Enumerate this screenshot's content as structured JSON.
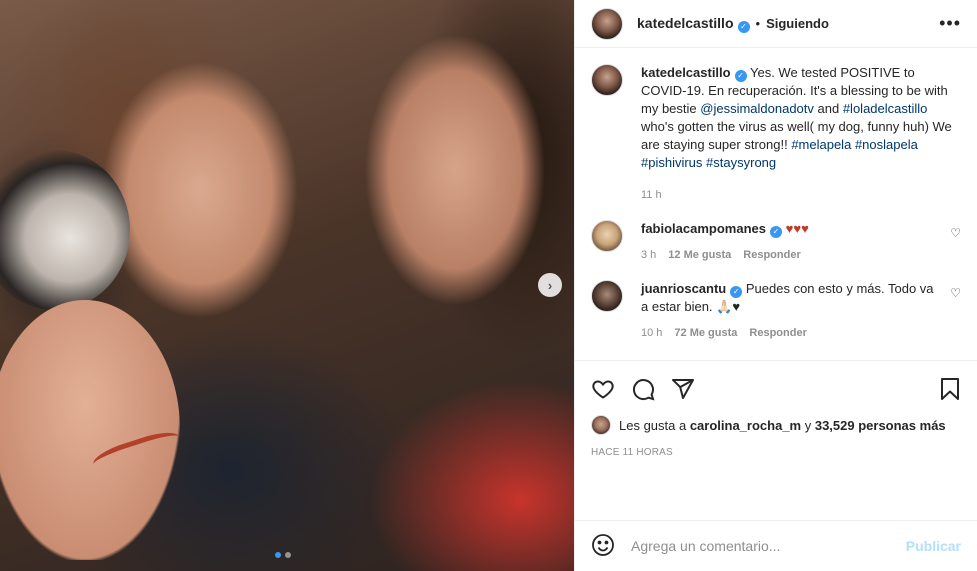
{
  "header": {
    "username": "katedelcastillo",
    "separator": "•",
    "follow_status": "Siguiendo",
    "more": "•••"
  },
  "caption": {
    "username": "katedelcastillo",
    "text_1": "Yes. We tested POSITIVE to COVID-19. En recuperación. It's a blessing to be with my bestie ",
    "mention_1": "@jessimaldonadotv",
    "text_2": " and ",
    "mention_2": "#loladelcastillo",
    "text_3": " who's gotten the virus as well( my dog, funny huh) We are staying super strong!! ",
    "hashtags": [
      "#melapela",
      "#noslapela",
      "#pishivirus",
      "#staysyrong"
    ],
    "time": "11 h"
  },
  "comments": [
    {
      "username": "fabiolacampomanes",
      "text": "♥♥♥",
      "time": "3 h",
      "likes": "12 Me gusta",
      "reply": "Responder"
    },
    {
      "username": "juanrioscantu",
      "text": "Puedes con esto y más. Todo va a estar bien. 🙏🏻♥",
      "time": "10 h",
      "likes": "72 Me gusta",
      "reply": "Responder"
    }
  ],
  "likes": {
    "prefix": "Les gusta a ",
    "user": "carolina_rocha_m",
    "middle": " y ",
    "count": "33,529 personas más"
  },
  "timestamp": "HACE 11 HORAS",
  "add_comment": {
    "placeholder": "Agrega un comentario...",
    "publish": "Publicar"
  },
  "carousel": {
    "total_slides": 2,
    "current_slide": 1
  },
  "colors": {
    "link": "#00376b",
    "verified": "#3897f0",
    "publish_disabled": "#b2dffc",
    "hearts": "#c0392b"
  }
}
